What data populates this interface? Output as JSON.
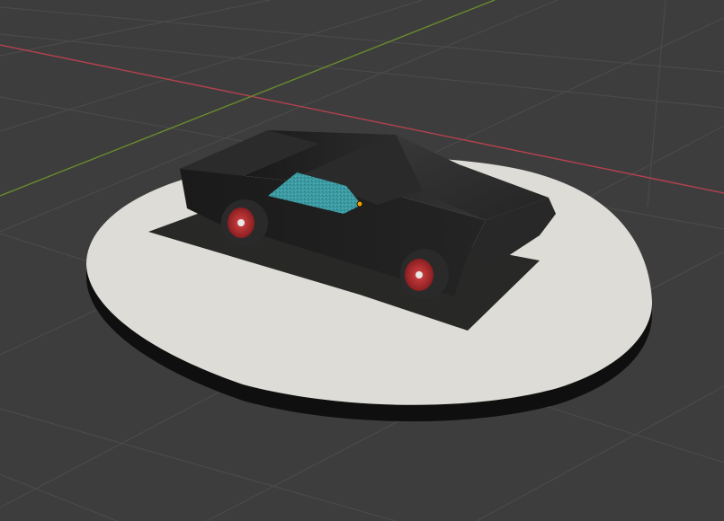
{
  "viewport": {
    "background_color": "#3d3d3d",
    "grid_color": "#4a4a4a",
    "x_axis_color": "#b5424f",
    "y_axis_color": "#6a8b2e"
  },
  "scene": {
    "turntable_color": "#dddcd6",
    "turntable_edge_color": "#0f0f0f",
    "car_body_color": "#1d1d1d",
    "window_color": "#3c9aa2",
    "wheel_rim_color": "#b52a2d",
    "tire_color": "#2a2a2a",
    "origin_marker_color": "#f0a000"
  }
}
